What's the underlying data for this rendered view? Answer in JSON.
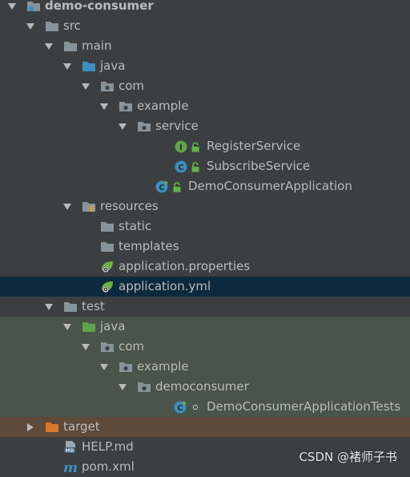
{
  "tree": {
    "nodes": [
      {
        "label": "demo-consumer",
        "level": 0,
        "arrow": "down",
        "icon": "module-folder-icon",
        "bold": true,
        "row": "normal"
      },
      {
        "label": "src",
        "level": 1,
        "arrow": "down",
        "icon": "folder-icon",
        "row": "normal"
      },
      {
        "label": "main",
        "level": 2,
        "arrow": "down",
        "icon": "folder-icon",
        "row": "normal"
      },
      {
        "label": "java",
        "level": 3,
        "arrow": "down",
        "icon": "source-folder-icon",
        "row": "normal"
      },
      {
        "label": "com",
        "level": 4,
        "arrow": "down",
        "icon": "package-icon",
        "row": "normal"
      },
      {
        "label": "example",
        "level": 5,
        "arrow": "down",
        "icon": "package-icon",
        "row": "normal"
      },
      {
        "label": "service",
        "level": 6,
        "arrow": "down",
        "icon": "package-icon",
        "row": "normal"
      },
      {
        "label": "RegisterService",
        "level": 8,
        "arrow": "none",
        "icon": "interface-icon",
        "badge": "lock-icon",
        "row": "normal"
      },
      {
        "label": "SubscribeService",
        "level": 8,
        "arrow": "none",
        "icon": "class-icon",
        "badge": "lock-icon",
        "row": "normal"
      },
      {
        "label": "DemoConsumerApplication",
        "level": 7,
        "arrow": "none",
        "icon": "spring-boot-class-icon",
        "badge": "lock-icon",
        "row": "normal"
      },
      {
        "label": "resources",
        "level": 3,
        "arrow": "down",
        "icon": "resources-folder-icon",
        "row": "normal"
      },
      {
        "label": "static",
        "level": 4,
        "arrow": "none",
        "icon": "folder-icon",
        "row": "normal"
      },
      {
        "label": "templates",
        "level": 4,
        "arrow": "none",
        "icon": "folder-icon",
        "row": "normal"
      },
      {
        "label": "application.properties",
        "level": 4,
        "arrow": "none",
        "icon": "spring-config-icon",
        "row": "normal"
      },
      {
        "label": "application.yml",
        "level": 4,
        "arrow": "none",
        "icon": "spring-config-icon",
        "row": "selected"
      },
      {
        "label": "test",
        "level": 2,
        "arrow": "down",
        "icon": "folder-icon",
        "row": "normal"
      },
      {
        "label": "java",
        "level": 3,
        "arrow": "down",
        "icon": "test-source-folder-icon",
        "row": "test"
      },
      {
        "label": "com",
        "level": 4,
        "arrow": "down",
        "icon": "package-icon",
        "row": "test"
      },
      {
        "label": "example",
        "level": 5,
        "arrow": "down",
        "icon": "package-icon",
        "row": "test"
      },
      {
        "label": "democonsumer",
        "level": 6,
        "arrow": "down",
        "icon": "package-icon",
        "row": "test"
      },
      {
        "label": "DemoConsumerApplicationTests",
        "level": 8,
        "arrow": "none",
        "icon": "test-class-icon",
        "badge": "dot-icon",
        "row": "test"
      },
      {
        "label": "target",
        "level": 1,
        "arrow": "right",
        "icon": "excluded-folder-icon",
        "row": "excluded"
      },
      {
        "label": "HELP.md",
        "level": 2,
        "arrow": "none",
        "icon": "markdown-file-icon",
        "row": "normal"
      },
      {
        "label": "pom.xml",
        "level": 2,
        "arrow": "none",
        "icon": "maven-file-icon",
        "row": "normal"
      }
    ]
  },
  "watermark": "CSDN @褚师子书",
  "colors": {
    "background": "#3c3f41",
    "selected_row": "#0d293e",
    "test_row": "#49544a",
    "excluded_row": "#5d4a3a",
    "text": "#bbbbbb",
    "folder": "#87939a",
    "source_folder": "#3d8fc3",
    "test_folder": "#62a24a",
    "excluded_folder": "#d9772c",
    "class_circle": "#3c8dbc",
    "interface_circle": "#62a24a",
    "lock": "#62b543",
    "spring_leaf": "#6db33f"
  }
}
